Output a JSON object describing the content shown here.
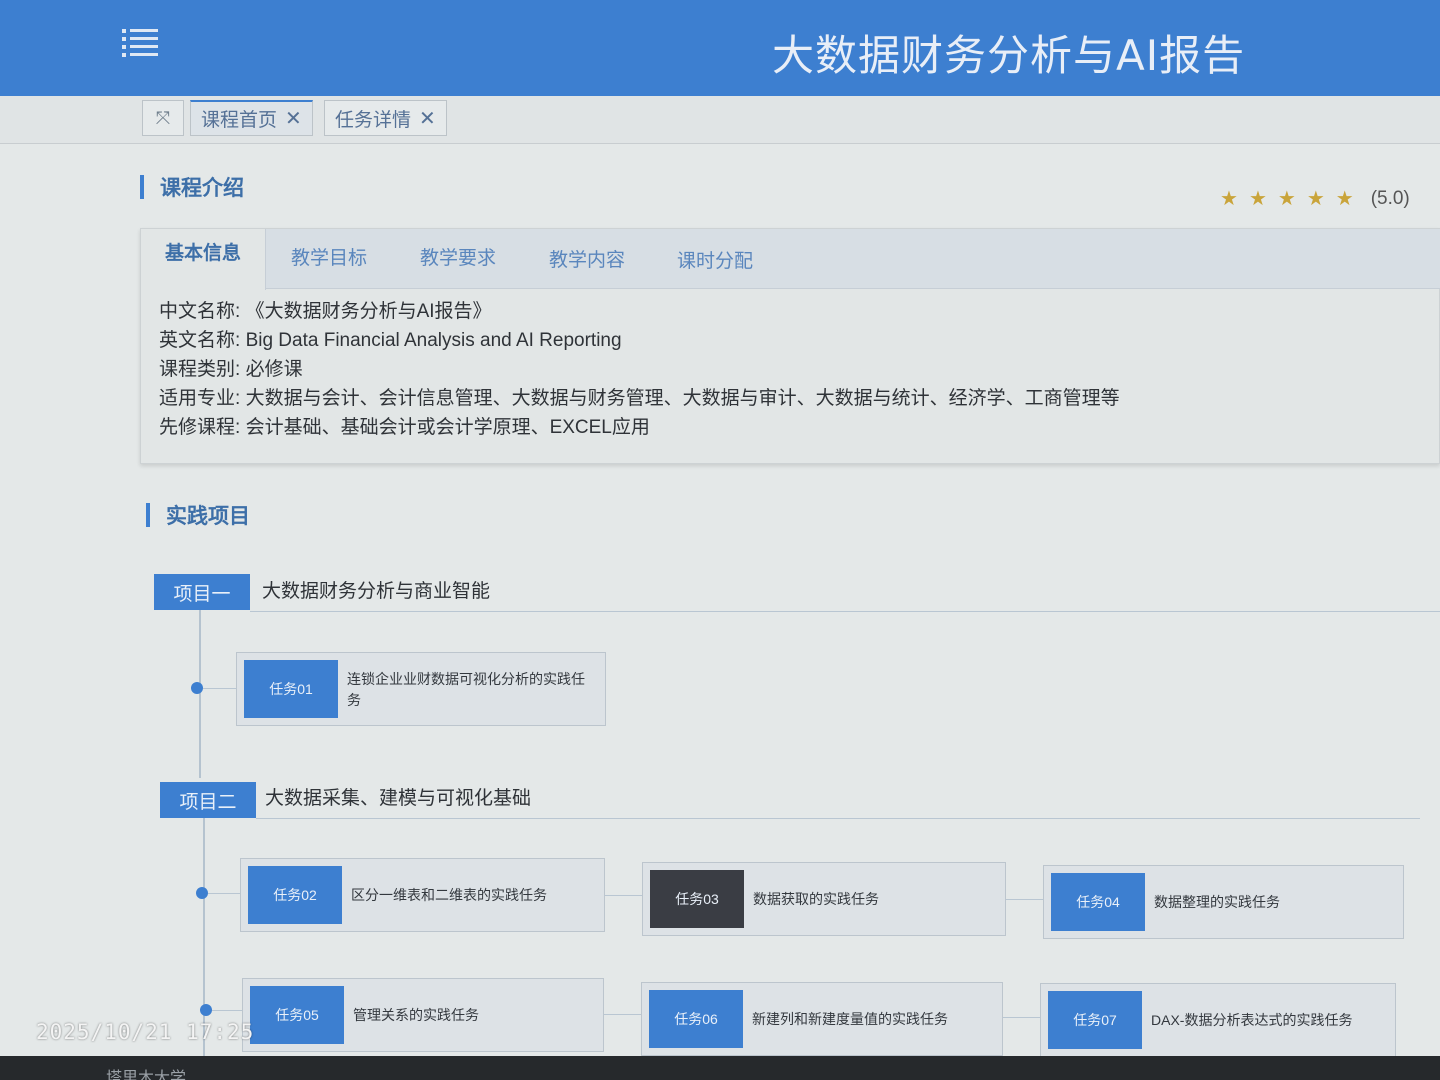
{
  "header": {
    "title": "大数据财务分析与AI报告",
    "menu_icon": "menu-list-icon"
  },
  "tabs": [
    {
      "label": "课程首页",
      "active": true
    },
    {
      "label": "任务详情",
      "active": false
    }
  ],
  "intro": {
    "heading": "课程介绍",
    "rating": {
      "stars": 5,
      "max": 5,
      "score_text": "(5.0)"
    },
    "subtabs": [
      "基本信息",
      "教学目标",
      "教学要求",
      "教学内容",
      "课时分配"
    ],
    "rows": [
      {
        "key": "中文名称:",
        "value": "《大数据财务分析与AI报告》"
      },
      {
        "key": "英文名称:",
        "value": "Big Data Financial Analysis and AI Reporting"
      },
      {
        "key": "课程类别:",
        "value": "必修课"
      },
      {
        "key": "适用专业:",
        "value": "大数据与会计、会计信息管理、大数据与财务管理、大数据与审计、大数据与统计、经济学、工商管理等"
      },
      {
        "key": "先修课程:",
        "value": "会计基础、基础会计或会计学原理、EXCEL应用"
      }
    ]
  },
  "practice": {
    "heading": "实践项目",
    "projects": [
      {
        "badge": "项目一",
        "title": "大数据财务分析与商业智能",
        "tasks": [
          {
            "code": "任务01",
            "name": "连锁企业业财数据可视化分析的实践任务"
          }
        ]
      },
      {
        "badge": "项目二",
        "title": "大数据采集、建模与可视化基础",
        "tasks": [
          {
            "code": "任务02",
            "name": "区分一维表和二维表的实践任务"
          },
          {
            "code": "任务03",
            "name": "数据获取的实践任务"
          },
          {
            "code": "任务04",
            "name": "数据整理的实践任务"
          },
          {
            "code": "任务05",
            "name": "管理关系的实践任务"
          },
          {
            "code": "任务06",
            "name": "新建列和新建度量值的实践任务"
          },
          {
            "code": "任务07",
            "name": "DAX-数据分析表达式的实践任务"
          }
        ]
      }
    ]
  },
  "overlay": {
    "timestamp": "2025/10/21 17:25",
    "school": "塔里木大学"
  }
}
